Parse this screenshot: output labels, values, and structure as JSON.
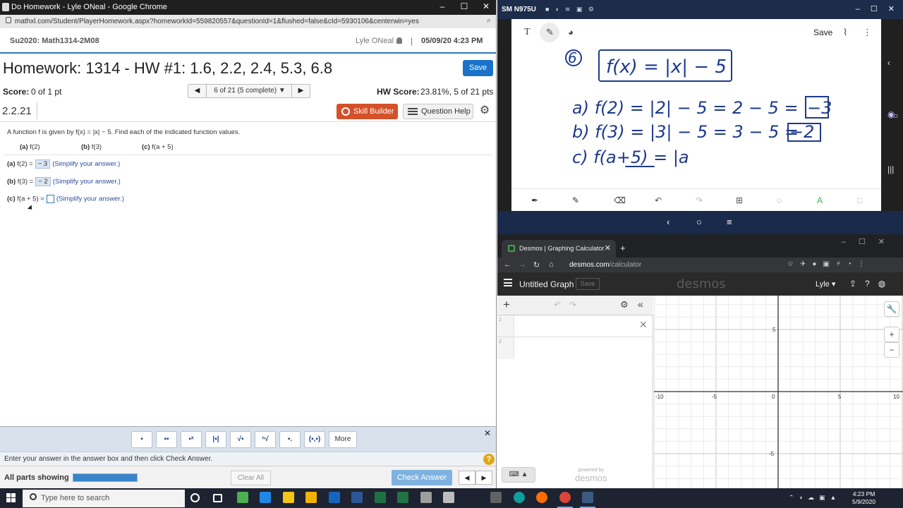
{
  "chrome": {
    "title": "Do Homework - Lyle ONeal - Google Chrome",
    "url": "mathxl.com/Student/PlayerHomework.aspx?homeworkId=559820557&questionId=1&flushed=false&cId=5930106&centerwin=yes",
    "controls": {
      "minimize": "–",
      "maximize": "☐",
      "close": "✕"
    }
  },
  "mathxl": {
    "course": "Su2020: Math1314-2M08",
    "user": "Lyle ONeal",
    "separator": "|",
    "datetime": "05/09/20 4:23 PM",
    "hw_title": "Homework: 1314 - HW #1: 1.6, 2.2, 2.4, 5.3, 6.8",
    "save_label": "Save",
    "score_label": "Score:",
    "score_value": "0 of 1 pt",
    "question_nav": "6 of 21 (5 complete) ▼",
    "hw_score_label": "HW Score:",
    "hw_score_value": "23.81%, 5 of 21 pts",
    "question_id": "2.2.21",
    "skill_builder": "Skill Builder",
    "question_help": "Question Help",
    "problem": "A function f is given by f(x) = |x| − 5. Find each of the indicated function values.",
    "parts": [
      {
        "tag": "(a)",
        "expr": "f(2)"
      },
      {
        "tag": "(b)",
        "expr": "f(3)"
      },
      {
        "tag": "(c)",
        "expr": "f(a + 5)"
      }
    ],
    "answers": [
      {
        "tag": "(a)",
        "lhs": "f(2) =",
        "value": "− 3",
        "hint": "(Simplify your answer.)"
      },
      {
        "tag": "(b)",
        "lhs": "f(3) =",
        "value": "− 2",
        "hint": "(Simplify your answer.)"
      },
      {
        "tag": "(c)",
        "lhs": "f(a + 5) =",
        "value": "",
        "hint": "(Simplify your answer.)"
      }
    ],
    "palette_more": "More",
    "instruction": "Enter your answer in the answer box and then click Check Answer.",
    "help_glyph": "?",
    "parts_showing": "All parts showing",
    "parts_progress": 1.0,
    "clear_all": "Clear All",
    "check_answer": "Check Answer"
  },
  "phone": {
    "device": "SM N975U",
    "note_save": "Save",
    "handwriting": {
      "problem_number": "6",
      "function": "f(x) = |x| − 5",
      "line_a": "a) f(2) = |2| − 5 = 2 − 5 =",
      "answer_a": "−3",
      "line_b": "b) f(3) = |3| − 5 = 3 − 5 =",
      "answer_b": "−2",
      "line_c": "c) f(a+5) = |a"
    }
  },
  "desmos": {
    "tab_title": "Desmos | Graphing Calculator",
    "url_host": "desmos.com",
    "url_path": "/calculator",
    "graph_title": "Untitled Graph",
    "save_label": "Save",
    "logo": "desmos",
    "user": "Lyle ▾",
    "expression_numbers": [
      "1",
      "2"
    ],
    "powered_by": "powered by",
    "powered_logo": "desmos",
    "axis": {
      "x_ticks": [
        "-10",
        "-5",
        "0",
        "5",
        "10"
      ],
      "y_ticks": [
        "5",
        "-5"
      ]
    }
  },
  "taskbar": {
    "search_placeholder": "Type here to search",
    "time": "4:23 PM",
    "date": "5/9/2020"
  },
  "colors": {
    "mathxl_blue": "#1a73c9",
    "skill_orange": "#d4512a",
    "ink_blue": "#1e3a8c",
    "desmos_dark": "#2a2a2a",
    "taskbar": "#1d2330"
  }
}
